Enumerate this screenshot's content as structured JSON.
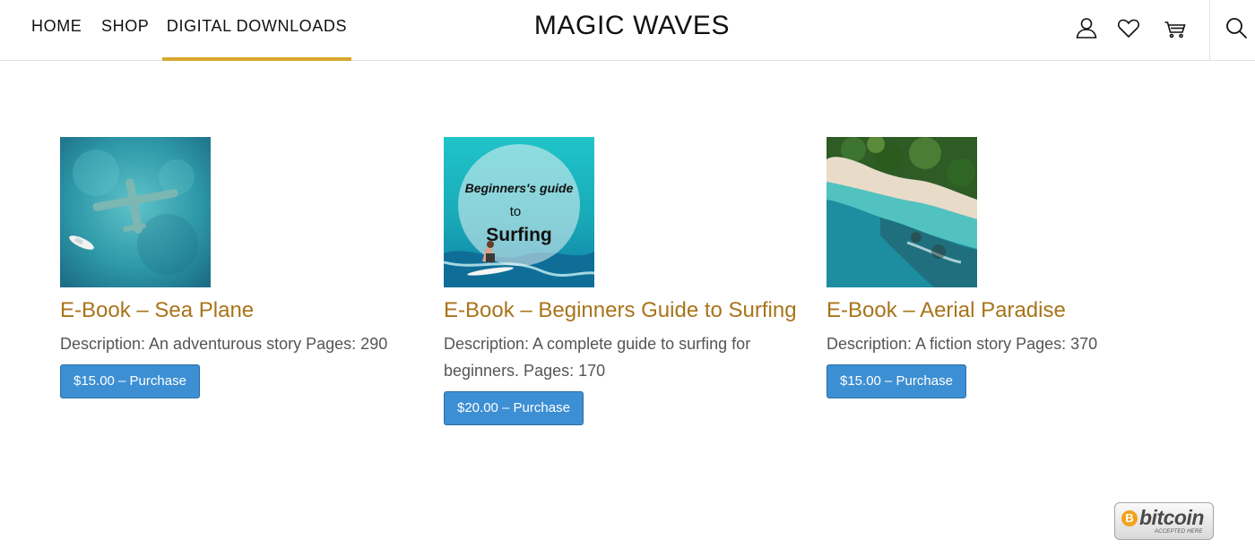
{
  "nav": {
    "items": [
      {
        "label": "HOME"
      },
      {
        "label": "SHOP"
      },
      {
        "label": "DIGITAL DOWNLOADS"
      }
    ],
    "active_index": 2
  },
  "brand": {
    "title": "MAGIC WAVES"
  },
  "header_icons": [
    "user-icon",
    "heart-icon",
    "cart-icon",
    "search-icon"
  ],
  "products": [
    {
      "title": "E-Book – Sea Plane",
      "description": "Description: An adventurous story Pages: 290",
      "button": "$15.00 – Purchase",
      "image": "sea-plane-aerial"
    },
    {
      "title": "E-Book – Beginners Guide to Surfing",
      "description": "Description: A complete guide to surfing for beginners. Pages: 170",
      "button": "$20.00 – Purchase",
      "image": "surfing-cover",
      "cover_text": {
        "line1": "Beginners's guide",
        "line2": "to",
        "line3": "Surfing"
      }
    },
    {
      "title": "E-Book – Aerial Paradise",
      "description": "Description: A fiction story Pages: 370",
      "button": "$15.00 – Purchase",
      "image": "aerial-paradise"
    }
  ],
  "badge": {
    "word": "bitcoin",
    "sub": "ACCEPTED HERE",
    "coin": "B"
  },
  "colors": {
    "accent": "#d7a72d",
    "title": "#a8741a",
    "button": "#3d8fd3",
    "bitcoin": "#f2a21d"
  }
}
